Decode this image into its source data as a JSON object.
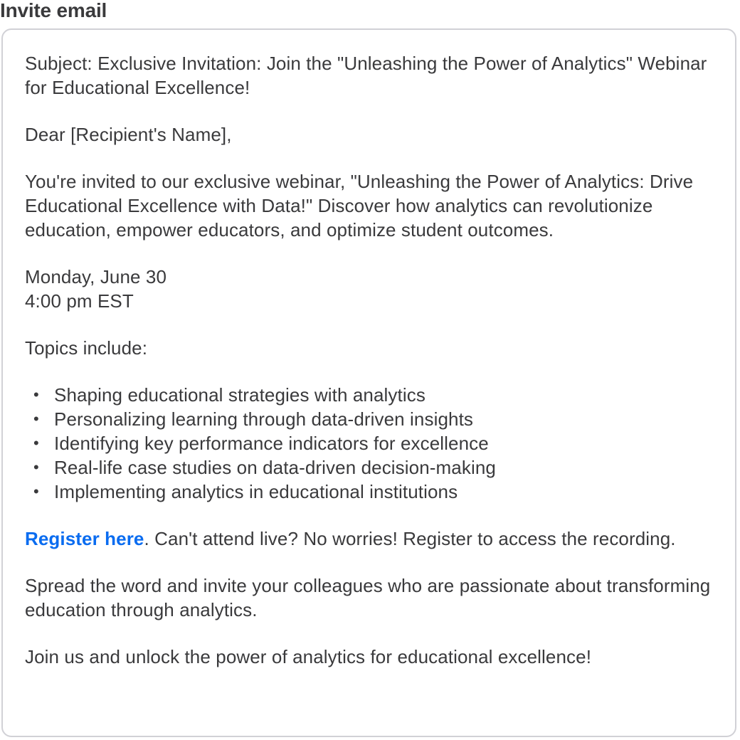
{
  "header": {
    "title": "Invite email"
  },
  "email": {
    "subject": "Subject: Exclusive Invitation: Join the \"Unleashing the Power of Analytics\" Webinar for Educational Excellence!",
    "greeting": "Dear [Recipient's Name],",
    "intro": "You're invited to our exclusive webinar, \"Unleashing the Power of Analytics: Drive Educational Excellence with Data!\" Discover how analytics can revolutionize education, empower educators, and optimize student outcomes.",
    "date": "Monday, June 30",
    "time": "4:00 pm EST",
    "topics_heading": "Topics include:",
    "bullet_glyph": "•",
    "topics": [
      "Shaping educational strategies with analytics",
      "Personalizing learning through data-driven insights",
      "Identifying key performance indicators for excellence",
      "Real-life case studies on data-driven decision-making",
      "Implementing analytics in educational institutions"
    ],
    "register_link": "Register here",
    "register_text": ". Can't attend live? No worries! Register to access the recording.",
    "spread_word": "Spread the word and invite your colleagues who are passionate about transforming education through analytics.",
    "closing": "Join us and unlock the power of analytics for educational excellence!"
  },
  "colors": {
    "text": "#3a3a3c",
    "link": "#0a6cf0",
    "border": "#d1d1d6",
    "background": "#ffffff"
  }
}
